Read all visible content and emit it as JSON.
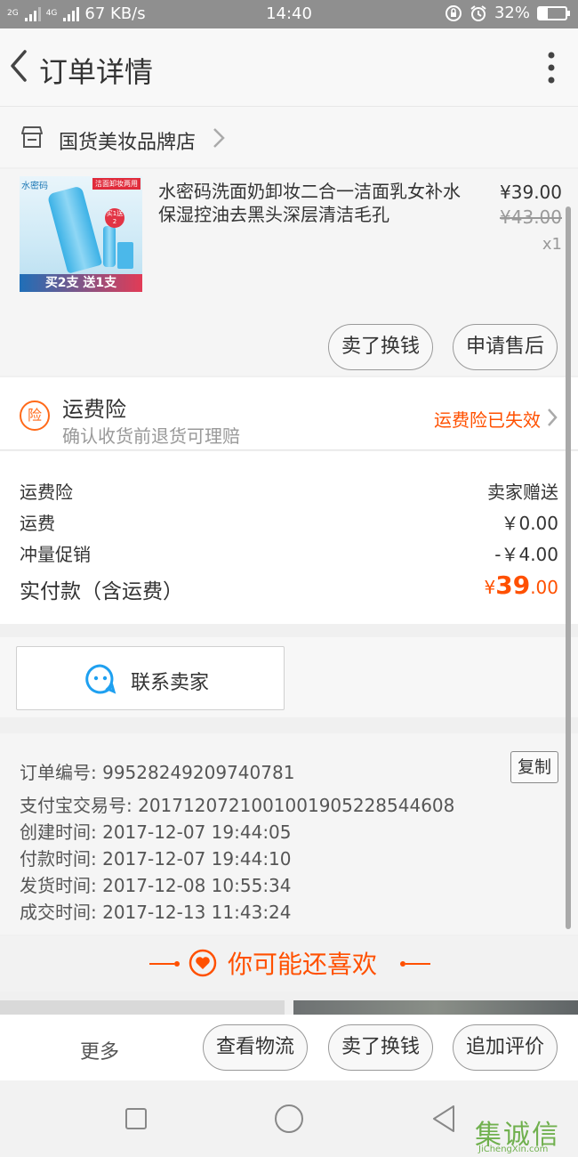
{
  "status_bar": {
    "network_1": "2G",
    "network_2": "4G",
    "speed": "67 KB/s",
    "time": "14:40",
    "battery_percent": "32%",
    "battery_level": 0.32
  },
  "header": {
    "title": "订单详情"
  },
  "shop": {
    "name": "国货美妆品牌店"
  },
  "product": {
    "image_brand_text": "水密码",
    "image_tag_text": "洁面卸妆两用",
    "image_badge_text": "买1送2",
    "image_promo_text": "买2支 送1支",
    "title": "水密码洗面奶卸妆二合一洁面乳女补水保湿控油去黑头深层清洁毛孔",
    "price": "¥39.00",
    "original_price": "¥43.00",
    "quantity": "x1",
    "buttons": {
      "sell": "卖了换钱",
      "after_sale": "申请售后"
    }
  },
  "shipping_insurance": {
    "icon_char": "险",
    "title": "运费险",
    "subtitle": "确认收货前退货可理赔",
    "status": "运费险已失效"
  },
  "fees": {
    "rows": [
      {
        "label": "运费险",
        "value": "卖家赠送"
      },
      {
        "label": "运费",
        "value": "￥0.00"
      },
      {
        "label": "冲量促销",
        "value": "-￥4.00"
      }
    ],
    "total_label": "实付款（含运费）",
    "total_currency": "¥",
    "total_int": "39",
    "total_dec": ".00"
  },
  "contact": {
    "label": "联系卖家"
  },
  "order_info": {
    "copy_label": "复制",
    "rows": [
      "订单编号: 99528249209740781",
      "支付宝交易号: 2017120721001001905228544608",
      "创建时间: 2017-12-07 19:44:05",
      "付款时间: 2017-12-07 19:44:10",
      "发货时间: 2017-12-08 10:55:34",
      "成交时间: 2017-12-13 11:43:24"
    ]
  },
  "recommend": {
    "title": "你可能还喜欢"
  },
  "bottom_bar": {
    "more": "更多",
    "logistics": "查看物流",
    "sell": "卖了换钱",
    "review": "追加评价"
  },
  "watermark": {
    "main": "集诚信",
    "sub": "JiChengXin.com"
  },
  "colors": {
    "accent": "#ff5000",
    "chat_blue": "#1ea0f0"
  }
}
